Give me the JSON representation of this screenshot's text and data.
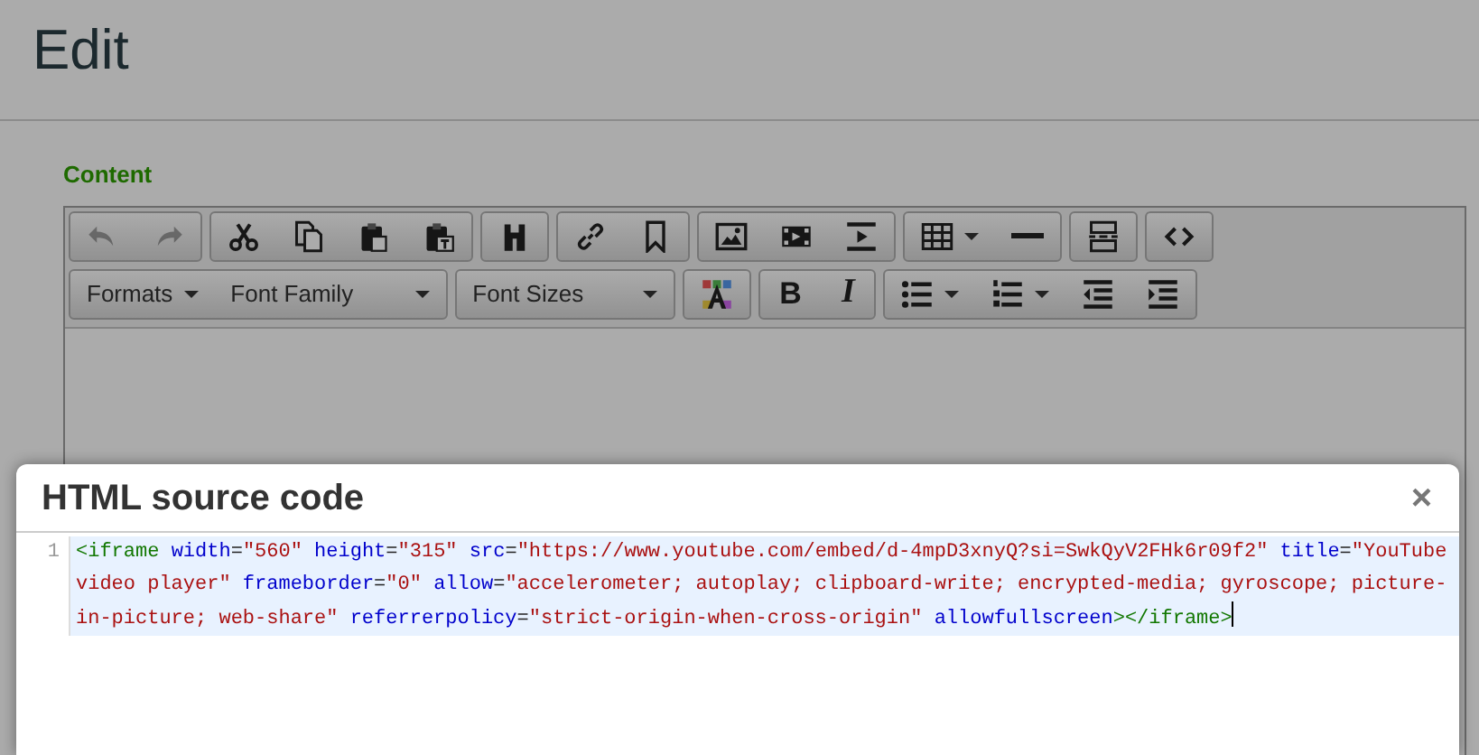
{
  "page": {
    "title": "Edit"
  },
  "field": {
    "label": "Content"
  },
  "toolbar": {
    "rows": [
      {
        "groups": [
          {
            "buttons": [
              {
                "kind": "icon",
                "disabled": true
              },
              {
                "kind": "icon",
                "disabled": true
              }
            ]
          },
          {
            "buttons": [
              {
                "kind": "icon",
                "disabled": false
              },
              {
                "kind": "icon",
                "disabled": false
              },
              {
                "kind": "icon",
                "disabled": false
              },
              {
                "kind": "icon",
                "disabled": false
              }
            ]
          },
          {
            "buttons": [
              {
                "kind": "icon",
                "disabled": false
              }
            ]
          },
          {
            "buttons": [
              {
                "kind": "icon",
                "disabled": false
              },
              {
                "kind": "icon",
                "disabled": false
              }
            ]
          },
          {
            "buttons": [
              {
                "kind": "icon",
                "disabled": false
              },
              {
                "kind": "icon",
                "disabled": false
              },
              {
                "kind": "icon",
                "disabled": false
              }
            ]
          },
          {
            "buttons": [
              {
                "kind": "icon-menu",
                "disabled": false
              },
              {
                "kind": "icon",
                "disabled": false
              }
            ]
          },
          {
            "buttons": [
              {
                "kind": "icon",
                "disabled": false
              }
            ]
          },
          {
            "buttons": [
              {
                "kind": "icon",
                "disabled": false
              }
            ]
          }
        ]
      },
      {
        "groups": [
          {
            "buttons": [
              {
                "kind": "menu",
                "label": "Formats"
              },
              {
                "kind": "menu",
                "label": "Font Family"
              }
            ]
          },
          {
            "buttons": [
              {
                "kind": "menu",
                "label": "Font Sizes"
              }
            ]
          },
          {
            "buttons": [
              {
                "kind": "icon",
                "disabled": false
              }
            ]
          },
          {
            "buttons": [
              {
                "kind": "glyph",
                "label": "B"
              },
              {
                "kind": "glyph",
                "label": "I"
              }
            ]
          },
          {
            "buttons": [
              {
                "kind": "icon-menu",
                "disabled": false
              },
              {
                "kind": "icon-menu",
                "disabled": false
              },
              {
                "kind": "icon",
                "disabled": false
              },
              {
                "kind": "icon",
                "disabled": false
              }
            ]
          }
        ]
      }
    ]
  },
  "dialog": {
    "title": "HTML source code",
    "close": "×",
    "code": {
      "line_number": "1",
      "caret_visible": true,
      "lines": [
        [
          {
            "kind": "tag",
            "text": "<iframe"
          },
          {
            "kind": "attr",
            "text": " width"
          },
          {
            "kind": "punct",
            "text": "="
          },
          {
            "kind": "value",
            "text": "\"560\""
          },
          {
            "kind": "attr",
            "text": " height"
          },
          {
            "kind": "punct",
            "text": "="
          },
          {
            "kind": "value",
            "text": "\"315\""
          },
          {
            "kind": "attr",
            "text": " src"
          },
          {
            "kind": "punct",
            "text": "="
          },
          {
            "kind": "value",
            "text": "\"https://www.youtube.com/embed/d-4mpD3xnyQ?si=SwkQyV2FHk6r09f2\""
          },
          {
            "kind": "attr",
            "text": " title"
          },
          {
            "kind": "punct",
            "text": "="
          },
          {
            "kind": "value",
            "text": "\"YouTube"
          }
        ],
        [
          {
            "kind": "value",
            "text": "video player\""
          },
          {
            "kind": "attr",
            "text": " frameborder"
          },
          {
            "kind": "punct",
            "text": "="
          },
          {
            "kind": "value",
            "text": "\"0\""
          },
          {
            "kind": "attr",
            "text": " allow"
          },
          {
            "kind": "punct",
            "text": "="
          },
          {
            "kind": "value",
            "text": "\"accelerometer; autoplay; clipboard-write; encrypted-media; gyroscope; picture-"
          }
        ],
        [
          {
            "kind": "value",
            "text": "in-picture; web-share\""
          },
          {
            "kind": "attr",
            "text": " referrerpolicy"
          },
          {
            "kind": "punct",
            "text": "="
          },
          {
            "kind": "value",
            "text": "\"strict-origin-when-cross-origin\""
          },
          {
            "kind": "attr",
            "text": " allowfullscreen"
          },
          {
            "kind": "tag",
            "text": "></iframe>"
          }
        ]
      ]
    }
  }
}
